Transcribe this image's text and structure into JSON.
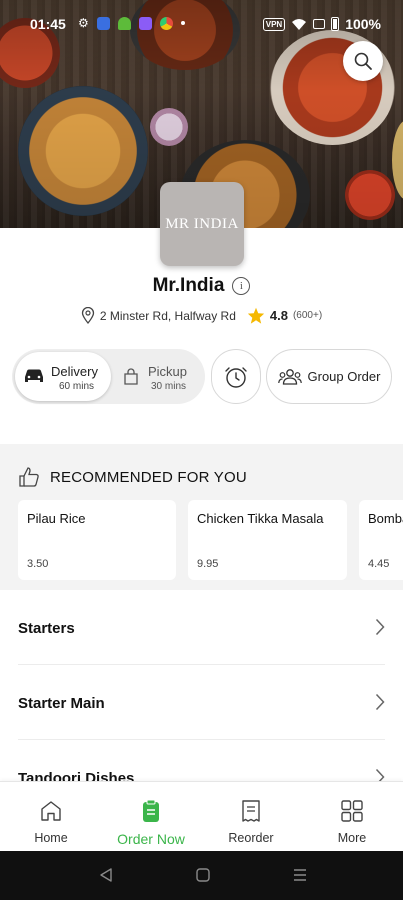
{
  "status_bar": {
    "time": "01:45",
    "battery": "100%",
    "vpn": "VPN"
  },
  "restaurant": {
    "logo_text": "MR INDIA",
    "name": "Mr.India",
    "address": "2  Minster Rd, Halfway Rd",
    "rating": "4.8",
    "rating_count": "(600+)"
  },
  "order_modes": {
    "delivery_label": "Delivery",
    "delivery_time": "60 mins",
    "pickup_label": "Pickup",
    "pickup_time": "30 mins",
    "group_order_label": "Group Order"
  },
  "recommended": {
    "title": "RECOMMENDED FOR YOU",
    "items": [
      {
        "name": "Pilau Rice",
        "price": "3.50"
      },
      {
        "name": "Chicken Tikka Masala",
        "price": "9.95"
      },
      {
        "name": "Bombay",
        "price": "4.45"
      }
    ]
  },
  "categories": [
    {
      "label": "Starters"
    },
    {
      "label": "Starter Main"
    },
    {
      "label": "Tandoori Dishes"
    }
  ],
  "bottom_nav": [
    {
      "label": "Home",
      "icon": "home-icon"
    },
    {
      "label": "Order Now",
      "icon": "order-icon",
      "active": true
    },
    {
      "label": "Reorder",
      "icon": "receipt-icon"
    },
    {
      "label": "More",
      "icon": "grid-icon"
    }
  ],
  "colors": {
    "accent": "#3bb54a",
    "star": "#f5b800"
  }
}
